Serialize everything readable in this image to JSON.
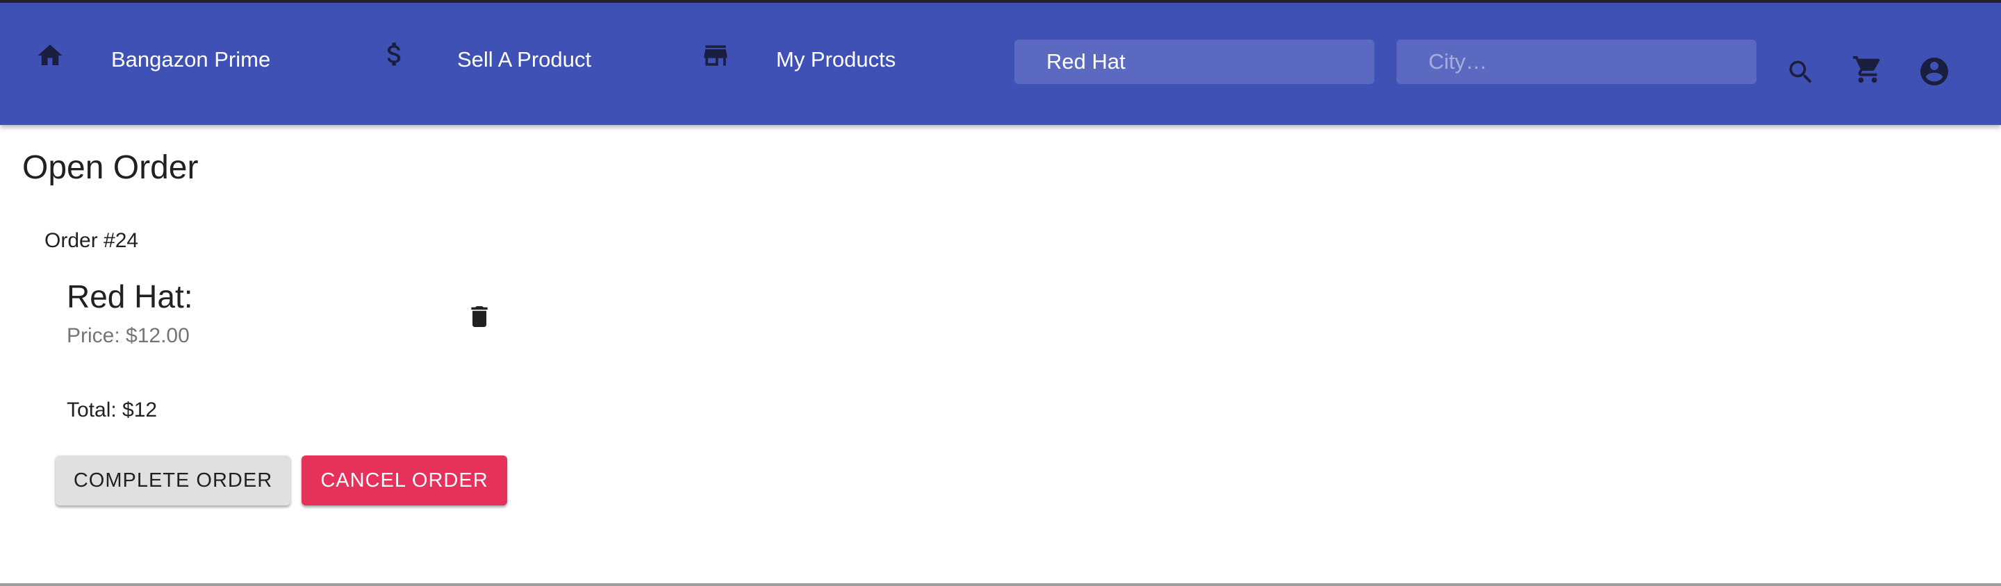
{
  "nav": {
    "brand": {
      "label": "Bangazon Prime",
      "icon": "home-icon"
    },
    "sell": {
      "label": "Sell A Product",
      "icon": "dollar-icon"
    },
    "my_products": {
      "label": "My Products",
      "icon": "store-icon"
    },
    "search": {
      "value": "Red Hat",
      "placeholder": ""
    },
    "city": {
      "value": "",
      "placeholder": "City…"
    },
    "actions": [
      "search-icon",
      "cart-icon",
      "account-circle-icon"
    ]
  },
  "page": {
    "title": "Open Order"
  },
  "order": {
    "number": "Order #24",
    "items": [
      {
        "name": "Red Hat:",
        "price": "Price: $12.00",
        "action_icon": "trash-icon"
      }
    ],
    "total": "Total: $12"
  },
  "buttons": {
    "complete": "Complete Order",
    "cancel": "Cancel Order"
  },
  "colors": {
    "appbar": "#3f51b5",
    "secondary": "#e6325b",
    "default_button": "#e0e0e0",
    "text_primary": "#212121",
    "text_secondary": "#757575"
  }
}
